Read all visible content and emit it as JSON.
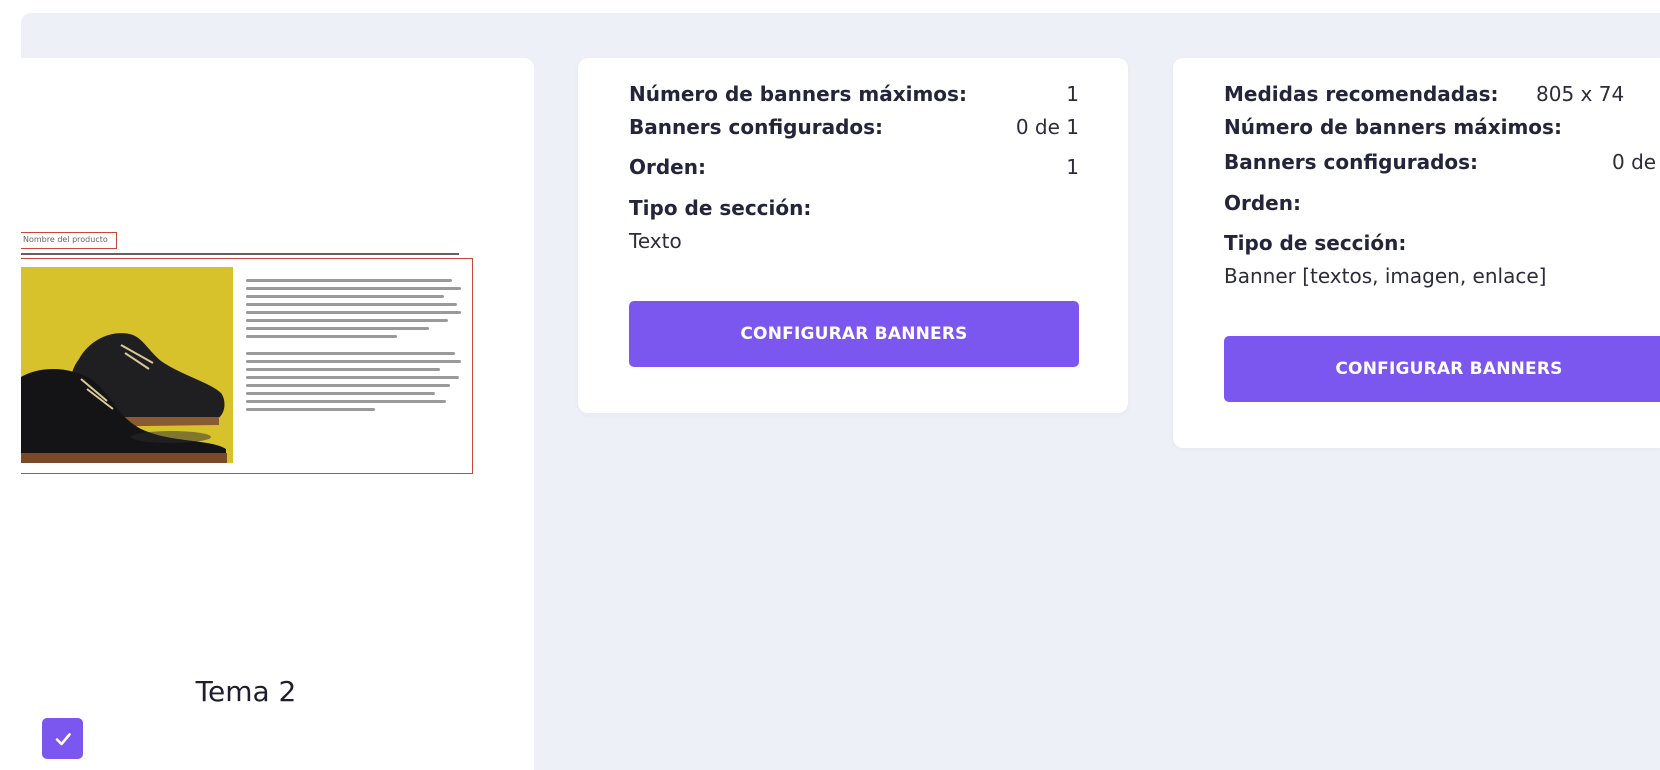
{
  "theme": {
    "name": "Tema 2",
    "selected": true,
    "preview_tag": "Nombre del producto"
  },
  "cards": [
    {
      "max_banners_label": "Número de banners máximos:",
      "max_banners_value": "1",
      "configured_label": "Banners configurados:",
      "configured_value": "0 de 1",
      "order_label": "Orden:",
      "order_value": "1",
      "section_type_label": "Tipo de sección:",
      "section_type_value": "Texto",
      "button_label": "CONFIGURAR BANNERS"
    },
    {
      "sizes_label": "Medidas recomendadas:",
      "sizes_value": "805 x 74",
      "max_banners_label": "Número de banners máximos:",
      "configured_label": "Banners configurados:",
      "configured_value": "0 de",
      "order_label": "Orden:",
      "section_type_label": "Tipo de sección:",
      "section_type_value": "Banner [textos, imagen, enlace]",
      "button_label": "CONFIGURAR BANNERS"
    }
  ],
  "colors": {
    "accent": "#7b57ef",
    "background": "#eef0f7",
    "preview_border": "#c8463a",
    "preview_photo_bg": "#d8c22c"
  }
}
